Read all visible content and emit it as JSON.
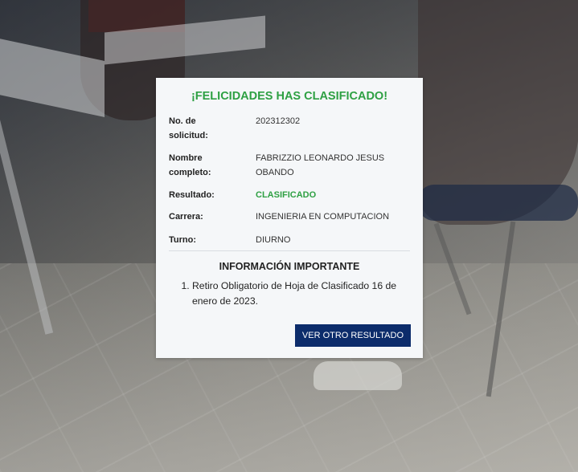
{
  "card": {
    "title": "¡FELICIDADES HAS CLASIFICADO!",
    "rows": [
      {
        "label": "No. de solicitud:",
        "value": "202312302"
      },
      {
        "label": "Nombre completo:",
        "value": "FABRIZZIO LEONARDO JESUS OBANDO"
      },
      {
        "label": "Resultado:",
        "value": "CLASIFICADO"
      },
      {
        "label": "Carrera:",
        "value": "INGENIERIA EN COMPUTACION"
      },
      {
        "label": "Turno:",
        "value": "DIURNO"
      }
    ],
    "info_title": "INFORMACIÓN IMPORTANTE",
    "info_items": [
      "Retiro Obligatorio de Hoja de Clasificado 16 de enero de 2023."
    ],
    "button_label": "VER OTRO RESULTADO"
  },
  "colors": {
    "success": "#2ea043",
    "button": "#0c2c6b",
    "card_bg": "#f5f7f9"
  }
}
